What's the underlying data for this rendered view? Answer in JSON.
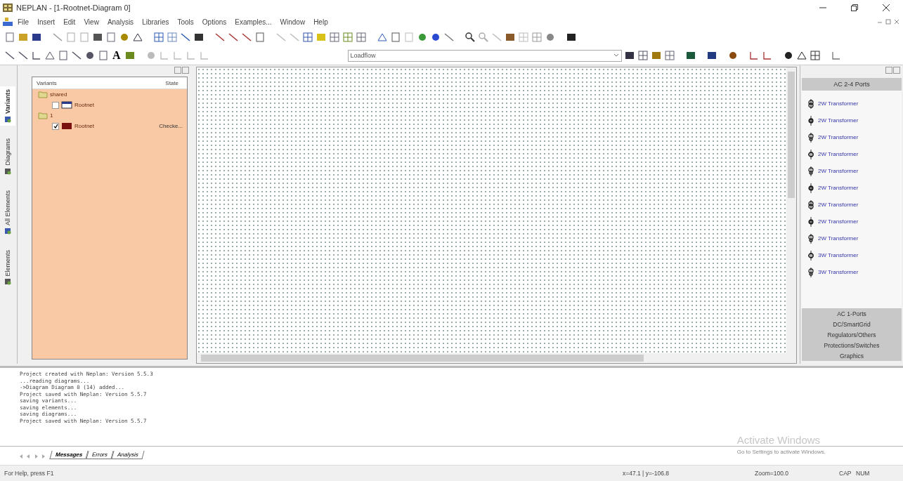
{
  "window": {
    "title": "NEPLAN - [1-Rootnet-Diagram 0]"
  },
  "menu": [
    "File",
    "Insert",
    "Edit",
    "View",
    "Analysis",
    "Libraries",
    "Tools",
    "Options",
    "Examples...",
    "Window",
    "Help"
  ],
  "toolbar": {
    "text_tool": "A",
    "calculation_select": {
      "value": "Loadflow"
    }
  },
  "side_tabs": [
    {
      "label": "Variants",
      "selected": true
    },
    {
      "label": "Diagrams",
      "selected": false
    },
    {
      "label": "All Elements",
      "selected": false
    },
    {
      "label": "Elements",
      "selected": false
    }
  ],
  "variants_tree": {
    "columns": [
      "Variants",
      "State"
    ],
    "items": [
      {
        "label": "shared",
        "children": [
          {
            "label": "Rootnet",
            "checked": false
          }
        ]
      },
      {
        "label": "1",
        "children": [
          {
            "label": "Rootnet",
            "checked": true,
            "state": "Checke..."
          }
        ]
      }
    ]
  },
  "palette": {
    "open_group": "AC 2-4 Ports",
    "items": [
      "2W Transformer",
      "2W Transformer",
      "2W Transformer",
      "2W Transformer",
      "2W Transformer",
      "2W Transformer",
      "2W Transformer",
      "2W Transformer",
      "2W Transformer",
      "3W Transformer",
      "3W Transformer"
    ],
    "groups": [
      "AC 1-Ports",
      "DC/SmartGrid",
      "Regulators/Others",
      "Protections/Switches",
      "Graphics"
    ]
  },
  "messages": [
    "Project created with Neplan: Version 5.5.3",
    "...reading diagrams...",
    "->Diagram Diagram 0 (14) added...",
    "Project saved with Neplan: Version 5.5.7",
    "saving variants...",
    "saving elements...",
    "saving diagrams...",
    "Project saved with Neplan: Version 5.5.7"
  ],
  "message_tabs": [
    {
      "label": "Messages",
      "selected": true
    },
    {
      "label": "Errors",
      "selected": false
    },
    {
      "label": "Analysis",
      "selected": false
    }
  ],
  "activation_notice": {
    "title": "Activate Windows",
    "hint": "Go to Settings to activate Windows."
  },
  "status_bar": {
    "help": "For Help, press F1",
    "coords": "x=47.1 | y=-106.8",
    "zoom": "Zoom=100.0",
    "indicators": [
      "CAP",
      "NUM"
    ]
  }
}
